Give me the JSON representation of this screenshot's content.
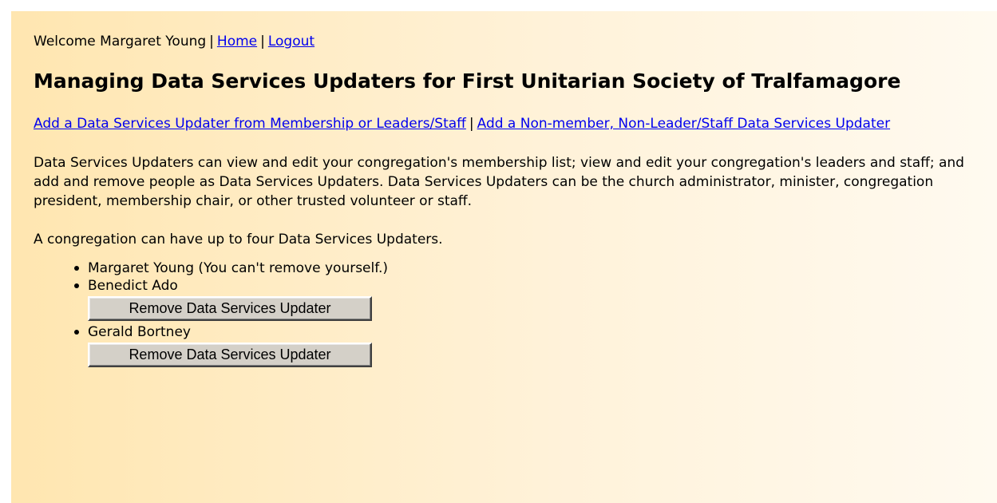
{
  "header": {
    "welcome": "Welcome Margaret Young",
    "separator": "|",
    "home_link": "Home",
    "logout_link": "Logout"
  },
  "page_title": "Managing Data Services Updaters for First Unitarian Society of Tralfamagore",
  "actions": {
    "add_from_membership": "Add a Data Services Updater from Membership or Leaders/Staff",
    "separator": "|",
    "add_non_member": "Add a Non-member, Non-Leader/Staff Data Services Updater"
  },
  "description": "Data Services Updaters can view and edit your congregation's membership list; view and edit your congregation's leaders and staff; and add and remove people as Data Services Updaters. Data Services Updaters can be the church administrator, minister, congregation president, membership chair, or other trusted volunteer or staff.",
  "limit_note": "A congregation can have up to four Data Services Updaters.",
  "updaters": [
    {
      "name": "Margaret Young (You can't remove yourself.)"
    },
    {
      "name": "Benedict Ado",
      "button": "Remove Data Services Updater"
    },
    {
      "name": "Gerald Bortney",
      "button": "Remove Data Services Updater"
    }
  ],
  "colors": {
    "background_left": "#ffe6b0",
    "background_right": "#fffaf0",
    "link": "#0000ee",
    "button_face": "#d4d0c8"
  }
}
